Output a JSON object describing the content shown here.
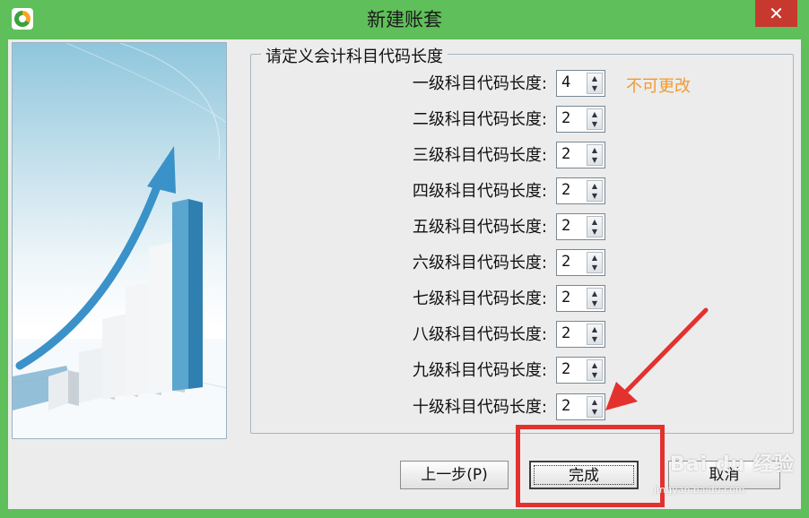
{
  "window": {
    "title": "新建账套",
    "app_icon": "app-logo-icon",
    "close_glyph": "✕"
  },
  "group": {
    "title": "请定义会计科目代码长度"
  },
  "levels": [
    {
      "label": "一级科目代码长度:",
      "value": "4"
    },
    {
      "label": "二级科目代码长度:",
      "value": "2"
    },
    {
      "label": "三级科目代码长度:",
      "value": "2"
    },
    {
      "label": "四级科目代码长度:",
      "value": "2"
    },
    {
      "label": "五级科目代码长度:",
      "value": "2"
    },
    {
      "label": "六级科目代码长度:",
      "value": "2"
    },
    {
      "label": "七级科目代码长度:",
      "value": "2"
    },
    {
      "label": "八级科目代码长度:",
      "value": "2"
    },
    {
      "label": "九级科目代码长度:",
      "value": "2"
    },
    {
      "label": "十级科目代码长度:",
      "value": "2"
    }
  ],
  "note": "不可更改",
  "buttons": {
    "prev": "上一步(P)",
    "finish": "完成",
    "cancel": "取消"
  },
  "watermark": {
    "main": "Bai du 经验",
    "sub": "jingyan.baidu.com"
  },
  "colors": {
    "titlebar": "#5fbf5a",
    "close": "#c7392f",
    "note": "#f29a2e",
    "highlight": "#e3322e"
  }
}
